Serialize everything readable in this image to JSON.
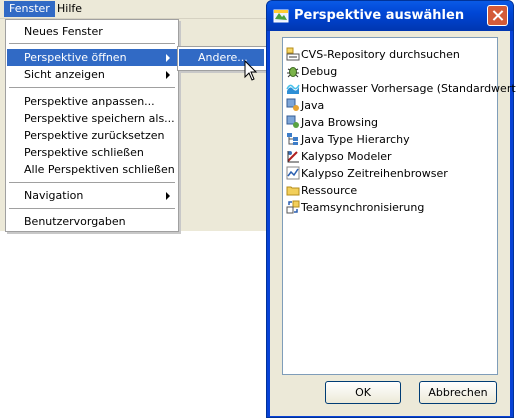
{
  "menubar": {
    "items": [
      "Fenster",
      "Hilfe"
    ]
  },
  "menu": {
    "items": [
      "Neues Fenster",
      "Perspektive öffnen",
      "Sicht anzeigen",
      "Perspektive anpassen...",
      "Perspektive speichern als...",
      "Perspektive zurücksetzen",
      "Perspektive schließen",
      "Alle Perspektiven schließen",
      "Navigation",
      "Benutzervorgaben"
    ]
  },
  "submenu": {
    "items": [
      "Andere..."
    ]
  },
  "dialog": {
    "title": "Perspektive auswählen",
    "perspectives": [
      "CVS-Repository durchsuchen",
      "Debug",
      "Hochwasser Vorhersage (Standardwert)",
      "Java",
      "Java Browsing",
      "Java Type Hierarchy",
      "Kalypso Modeler",
      "Kalypso Zeitreihenbrowser",
      "Ressource",
      "Teamsynchronisierung"
    ],
    "ok_label": "OK",
    "cancel_label": "Abbrechen"
  },
  "colors": {
    "highlight": "#316ac5",
    "titlebar": "#0046d5",
    "face": "#ece9d8"
  }
}
